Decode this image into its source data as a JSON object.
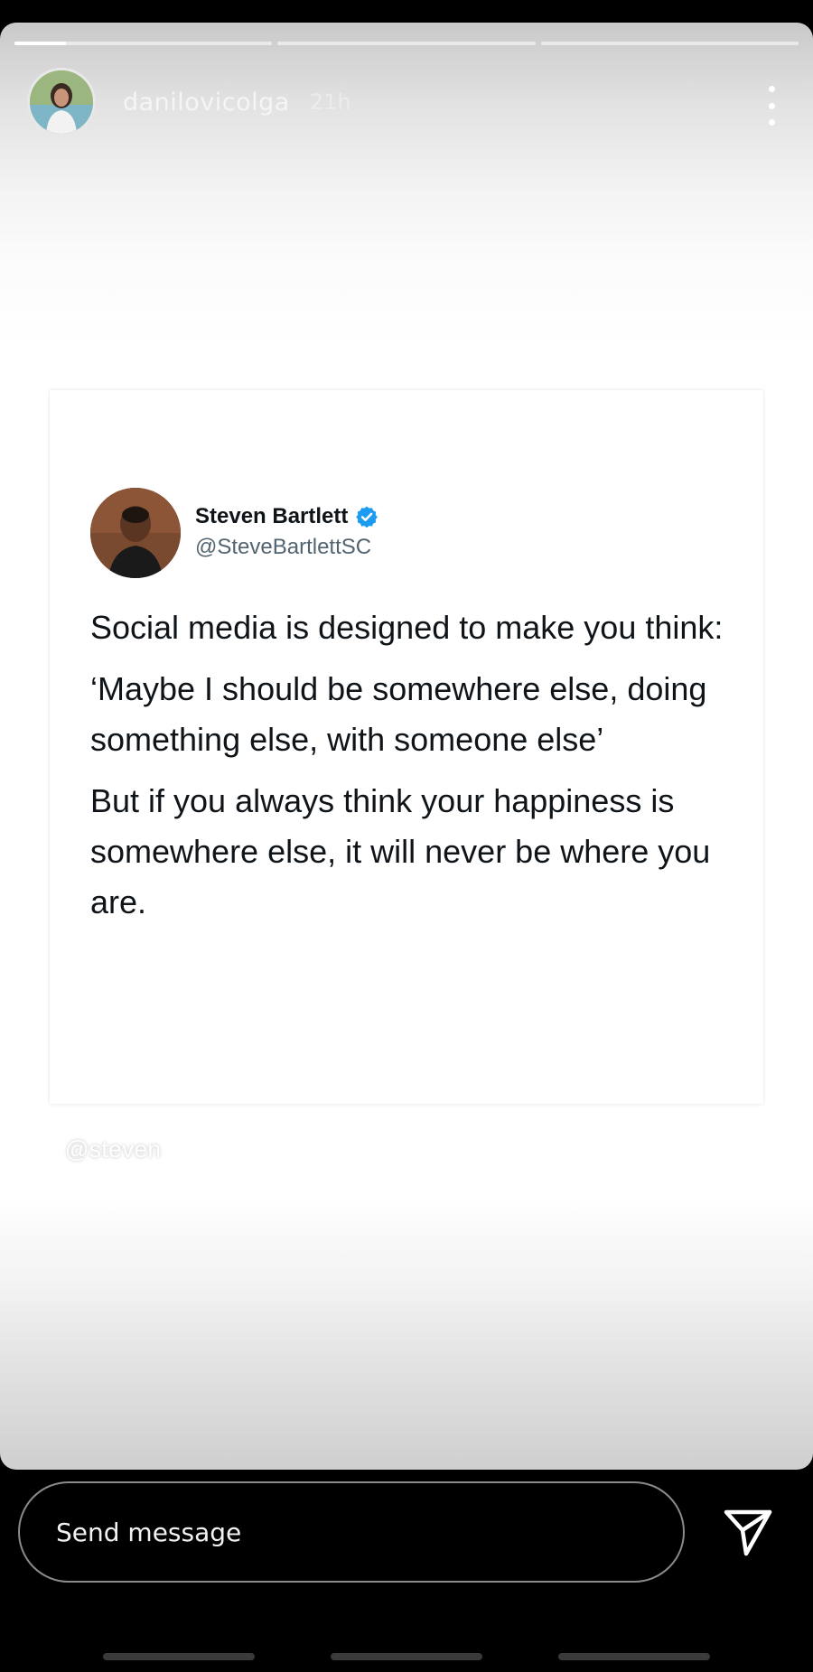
{
  "story": {
    "progress": [
      1.0,
      0.0,
      0.0
    ],
    "progress_first_fill": 0.2,
    "username": "danilovicolga",
    "timestamp": "21h",
    "mention_sticker": "@steven"
  },
  "tweet": {
    "author_name": "Steven Bartlett",
    "author_handle": "@SteveBartlettSC",
    "verified": true,
    "paragraphs": [
      "Social media is designed to make you think:",
      "‘Maybe I should be somewhere else, doing something else, with someone else’",
      "But if you always think your happiness is somewhere else, it will never be where you are."
    ]
  },
  "reply": {
    "placeholder": "Send message"
  },
  "colors": {
    "verified_blue": "#1d9bf0",
    "story_text": "#ffffff",
    "tweet_text": "#0f1419",
    "handle_gray": "#536471"
  },
  "icons": {
    "more": "vertical-dots-icon",
    "verified": "verified-badge-icon",
    "send": "paper-plane-icon"
  }
}
